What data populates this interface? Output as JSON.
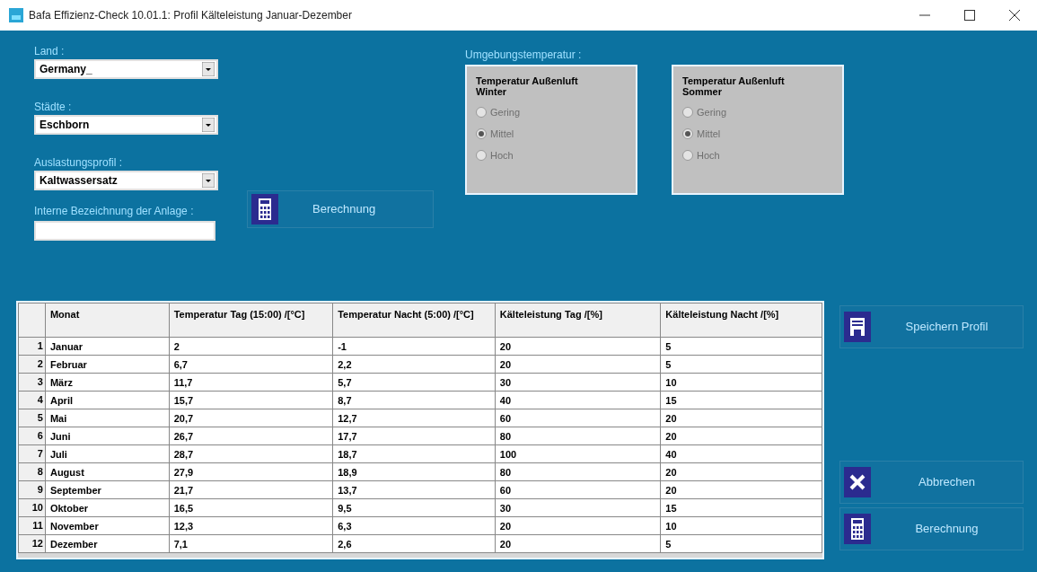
{
  "window": {
    "title": "Bafa Effizienz-Check 10.01.1: Profil Kälteleistung Januar-Dezember"
  },
  "form": {
    "land": {
      "label": "Land :",
      "value": "Germany_"
    },
    "staedte": {
      "label": "Städte :",
      "value": "Eschborn"
    },
    "auslastungsprofil": {
      "label": "Auslastungsprofil :",
      "value": "Kaltwassersatz"
    },
    "berechnung_button": "Berechnung",
    "interne_bezeichnung": {
      "label": "Interne Bezeichnung der Anlage :"
    }
  },
  "umgebung": {
    "label": "Umgebungstemperatur :",
    "groups": [
      {
        "title": "Temperatur Außenluft Winter",
        "options": [
          {
            "label": "Gering",
            "selected": false,
            "disabled": true
          },
          {
            "label": "Mittel",
            "selected": true,
            "disabled": true
          },
          {
            "label": "Hoch",
            "selected": false,
            "disabled": true
          }
        ]
      },
      {
        "title": "Temperatur Außenluft Sommer",
        "options": [
          {
            "label": "Gering",
            "selected": false,
            "disabled": true
          },
          {
            "label": "Mittel",
            "selected": true,
            "disabled": true
          },
          {
            "label": "Hoch",
            "selected": false,
            "disabled": true
          }
        ]
      }
    ]
  },
  "table": {
    "columns": [
      "Monat",
      "Temperatur Tag (15:00) /[°C]",
      "Temperatur Nacht (5:00) /[°C]",
      "Kälteleistung Tag /[%]",
      "Kälteleistung Nacht /[%]"
    ],
    "rows": [
      {
        "index": "1",
        "cells": [
          "Januar",
          "2",
          "-1",
          "20",
          "5"
        ]
      },
      {
        "index": "2",
        "cells": [
          "Februar",
          "6,7",
          "2,2",
          "20",
          "5"
        ]
      },
      {
        "index": "3",
        "cells": [
          "März",
          "11,7",
          "5,7",
          "30",
          "10"
        ]
      },
      {
        "index": "4",
        "cells": [
          "April",
          "15,7",
          "8,7",
          "40",
          "15"
        ]
      },
      {
        "index": "5",
        "cells": [
          "Mai",
          "20,7",
          "12,7",
          "60",
          "20"
        ]
      },
      {
        "index": "6",
        "cells": [
          "Juni",
          "26,7",
          "17,7",
          "80",
          "20"
        ]
      },
      {
        "index": "7",
        "cells": [
          "Juli",
          "28,7",
          "18,7",
          "100",
          "40"
        ]
      },
      {
        "index": "8",
        "cells": [
          "August",
          "27,9",
          "18,9",
          "80",
          "20"
        ]
      },
      {
        "index": "9",
        "cells": [
          "September",
          "21,7",
          "13,7",
          "60",
          "20"
        ]
      },
      {
        "index": "10",
        "cells": [
          "Oktober",
          "16,5",
          "9,5",
          "30",
          "15"
        ]
      },
      {
        "index": "11",
        "cells": [
          "November",
          "12,3",
          "6,3",
          "20",
          "10"
        ]
      },
      {
        "index": "12",
        "cells": [
          "Dezember",
          "7,1",
          "2,6",
          "20",
          "5"
        ]
      }
    ]
  },
  "side_buttons": [
    {
      "kind": "save",
      "label": "Speichern Profil"
    },
    {
      "kind": "cancel",
      "label": "Abbrechen"
    },
    {
      "kind": "calc",
      "label": "Berechnung"
    }
  ]
}
